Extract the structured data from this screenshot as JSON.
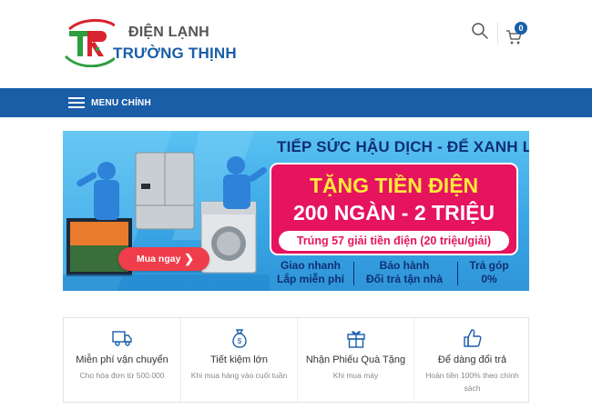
{
  "header": {
    "logo_line1": "ĐIỆN LẠNH",
    "logo_line2": "TRƯỜNG THỊNH",
    "search_icon": "search-icon",
    "cart_icon": "cart-icon",
    "cart_count": "0"
  },
  "nav": {
    "menu_label": "MENU CHÍNH",
    "menu_icon": "hamburger-icon"
  },
  "banner": {
    "headline": "TIẾP SỨC HẬU DỊCH - ĐỂ XANH LO",
    "promo_title": "TẶNG TIỀN ĐIỆN",
    "promo_amount": "200 NGÀN - 2 TRIỆU",
    "promo_sub": "Trúng 57 giải tiền điện (20 triệu/giải)",
    "features": [
      {
        "line1": "Giao nhanh",
        "line2": "Lắp miễn phí"
      },
      {
        "line1": "Bảo hành",
        "line2": "Đổi trả tận nhà"
      },
      {
        "line1": "Trả góp",
        "line2": "0%"
      }
    ],
    "buy_label": "Mua ngay",
    "buy_icon": "chevron-right-icon"
  },
  "services": [
    {
      "icon": "truck-icon",
      "title": "Miễn phí vận chuyển",
      "desc": "Cho hóa đơn từ 500.000"
    },
    {
      "icon": "money-bag-icon",
      "title": "Tiết kiệm lớn",
      "desc": "Khi mua hàng vào cuối tuần"
    },
    {
      "icon": "gift-icon",
      "title": "Nhận Phiếu Quà Tặng",
      "desc": "Khi mua máy"
    },
    {
      "icon": "thumbs-up-icon",
      "title": "Để dàng đổi trả",
      "desc": "Hoàn tiền 100% theo chính sách"
    }
  ],
  "colors": {
    "brand_blue": "#1a5ea8",
    "promo_pink": "#e6135f",
    "buy_red": "#ef3d4b",
    "logo_green": "#2e9e3e",
    "logo_red": "#d9232e"
  }
}
